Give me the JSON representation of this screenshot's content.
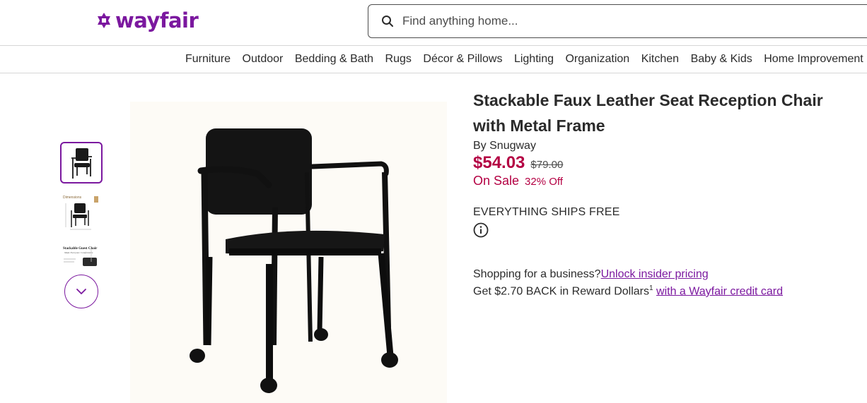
{
  "header": {
    "logo_text": "wayfair",
    "search": {
      "placeholder": "Find anything home..."
    }
  },
  "nav": {
    "items": [
      "Furniture",
      "Outdoor",
      "Bedding & Bath",
      "Rugs",
      "Décor & Pillows",
      "Lighting",
      "Organization",
      "Kitchen",
      "Baby & Kids",
      "Home Improvement"
    ]
  },
  "gallery": {
    "thumbnails": [
      "chair-front",
      "chair-dimensions",
      "chair-infographic"
    ],
    "thumb_2_caption": "Dimensions",
    "thumb_3_caption": "Stackable Guest Chair",
    "thumb_3_subcaption": "Make Everyone Comfortable",
    "selected_index": 0
  },
  "product": {
    "title": "Stackable Faux Leather Seat Reception Chair with Metal Frame",
    "brand_prefix": "By ",
    "brand": "Snugway",
    "price": "$54.03",
    "was_price": "$79.00",
    "sale_label": "On Sale",
    "discount_label": "32% Off",
    "shipping": "EVERYTHING SHIPS FREE",
    "business_text": "Shopping for a business?",
    "business_link": "Unlock insider pricing",
    "reward_text": "Get $2.70 BACK in Reward Dollars",
    "reward_footnote": "1",
    "reward_link": "with a Wayfair credit card"
  },
  "colors": {
    "brand_purple": "#7b189f",
    "sale_red": "#b40043"
  },
  "icons": {
    "search": "search-icon",
    "info": "info-icon",
    "chevron": "chevron-down-icon"
  }
}
